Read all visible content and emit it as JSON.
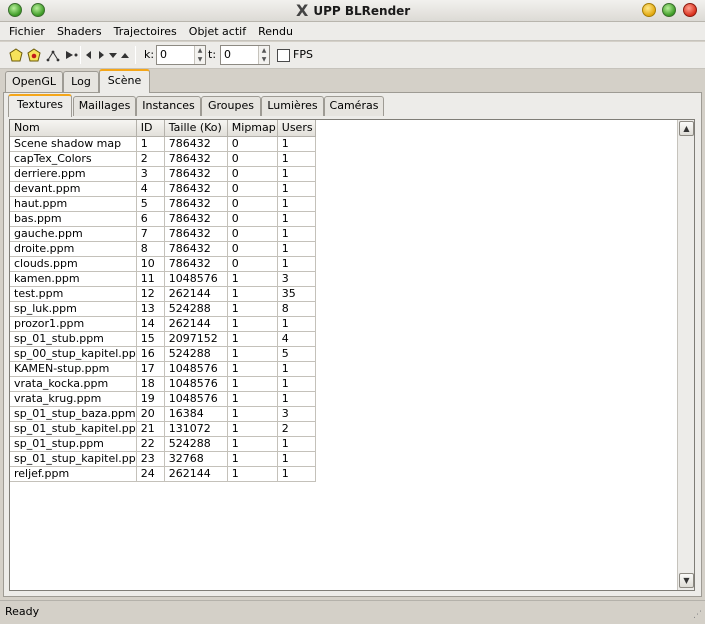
{
  "window": {
    "title": "UPP BLRender",
    "logo": "X"
  },
  "menu": [
    "Fichier",
    "Shaders",
    "Trajectoires",
    "Objet actif",
    "Rendu"
  ],
  "toolbar": {
    "icons": [
      "polygon-icon",
      "add-object-icon",
      "edit-path-icon",
      "play-step-icon",
      "arrow-left-icon",
      "arrow-right-icon",
      "arrow-down-icon",
      "arrow-up-icon"
    ],
    "k_label": "k:",
    "k_value": "0",
    "t_label": "t:",
    "t_value": "0",
    "fps_label": "FPS"
  },
  "main_tabs": [
    "OpenGL",
    "Log",
    "Scène"
  ],
  "active_main_tab": "Scène",
  "sub_tabs": [
    "Textures",
    "Maillages",
    "Instances",
    "Groupes",
    "Lumières",
    "Caméras"
  ],
  "active_sub_tab": "Textures",
  "table": {
    "columns": [
      "Nom",
      "ID",
      "Taille (Ko)",
      "Mipmap",
      "Users"
    ],
    "rows": [
      [
        "Scene shadow map",
        "1",
        "786432",
        "0",
        "1"
      ],
      [
        "capTex_Colors",
        "2",
        "786432",
        "0",
        "1"
      ],
      [
        "derriere.ppm",
        "3",
        "786432",
        "0",
        "1"
      ],
      [
        "devant.ppm",
        "4",
        "786432",
        "0",
        "1"
      ],
      [
        "haut.ppm",
        "5",
        "786432",
        "0",
        "1"
      ],
      [
        "bas.ppm",
        "6",
        "786432",
        "0",
        "1"
      ],
      [
        "gauche.ppm",
        "7",
        "786432",
        "0",
        "1"
      ],
      [
        "droite.ppm",
        "8",
        "786432",
        "0",
        "1"
      ],
      [
        "clouds.ppm",
        "10",
        "786432",
        "0",
        "1"
      ],
      [
        "kamen.ppm",
        "11",
        "1048576",
        "1",
        "3"
      ],
      [
        "test.ppm",
        "12",
        "262144",
        "1",
        "35"
      ],
      [
        "sp_luk.ppm",
        "13",
        "524288",
        "1",
        "8"
      ],
      [
        "prozor1.ppm",
        "14",
        "262144",
        "1",
        "1"
      ],
      [
        "sp_01_stub.ppm",
        "15",
        "2097152",
        "1",
        "4"
      ],
      [
        "sp_00_stup_kapitel.pp",
        "16",
        "524288",
        "1",
        "5"
      ],
      [
        "KAMEN-stup.ppm",
        "17",
        "1048576",
        "1",
        "1"
      ],
      [
        "vrata_kocka.ppm",
        "18",
        "1048576",
        "1",
        "1"
      ],
      [
        "vrata_krug.ppm",
        "19",
        "1048576",
        "1",
        "1"
      ],
      [
        "sp_01_stup_baza.ppm",
        "20",
        "16384",
        "1",
        "3"
      ],
      [
        "sp_01_stub_kapitel.pp",
        "21",
        "131072",
        "1",
        "2"
      ],
      [
        "sp_01_stup.ppm",
        "22",
        "524288",
        "1",
        "1"
      ],
      [
        "sp_01_stup_kapitel.pp",
        "23",
        "32768",
        "1",
        "1"
      ],
      [
        "reljef.ppm",
        "24",
        "262144",
        "1",
        "1"
      ]
    ]
  },
  "status": "Ready"
}
